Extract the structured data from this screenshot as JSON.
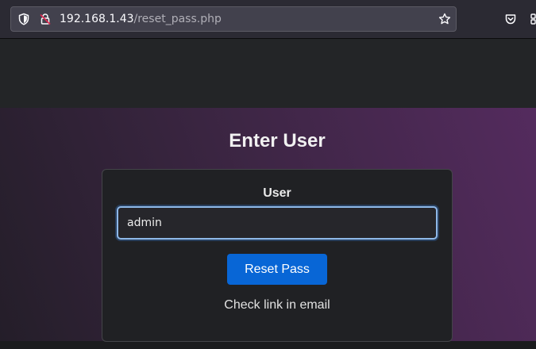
{
  "browser": {
    "url_host": "192.168.1.43",
    "url_path": "/reset_pass.php",
    "icons": {
      "tracking": "shield-icon",
      "lock": "insecure-lock-icon",
      "bookmark": "bookmark-star-icon",
      "pocket": "pocket-icon",
      "extensions": "extensions-icon"
    }
  },
  "page": {
    "title": "Enter User",
    "form": {
      "user_label": "User",
      "user_value": "admin",
      "submit_label": "Reset Pass",
      "status_message": "Check link in email"
    }
  },
  "colors": {
    "button": "#0866d6",
    "input_focus": "#8eb8e8",
    "gradient_start": "#241e29",
    "gradient_end": "#542b5e"
  }
}
